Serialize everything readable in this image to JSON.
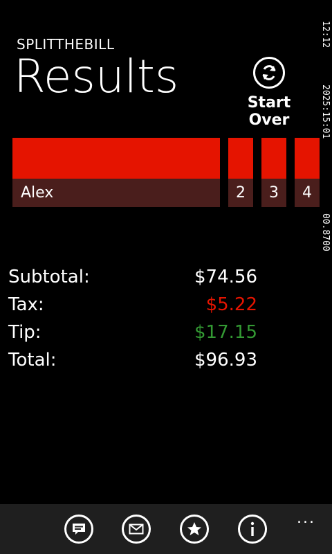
{
  "header": {
    "app_title": "SPLITTHEBILL",
    "page_title": "Results"
  },
  "actions": {
    "start_over_label": "Start Over"
  },
  "people": [
    {
      "label": "Alex"
    },
    {
      "label": "2"
    },
    {
      "label": "3"
    },
    {
      "label": "4"
    }
  ],
  "system_tray": {
    "line1": "12:12",
    "line2": "2025:15:01",
    "line3": "00.8700"
  },
  "summary": {
    "subtotal_label": "Subtotal:",
    "subtotal_value": "$74.56",
    "tax_label": "Tax:",
    "tax_value": "$5.22",
    "tip_label": "Tip:",
    "tip_value": "$17.15",
    "total_label": "Total:",
    "total_value": "$96.93"
  },
  "app_bar": {
    "buttons": [
      "chat-icon",
      "mail-icon",
      "star-icon",
      "info-icon"
    ],
    "more": "..."
  },
  "colors": {
    "accent": "#e51400",
    "tile_dark": "#4a1e1c",
    "tip_green": "#339933",
    "appbar_bg": "#1f1f1f"
  }
}
